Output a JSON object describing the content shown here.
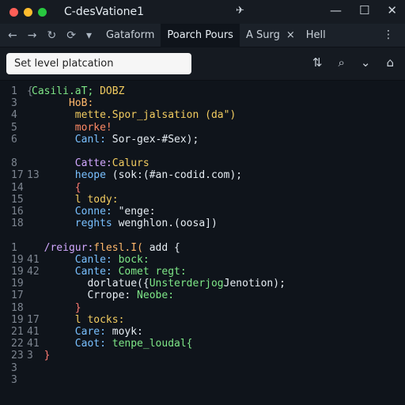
{
  "window": {
    "title": "C-desVatione1",
    "traffic_colors": [
      "#ff5f57",
      "#febc2e",
      "#28c840"
    ],
    "pin_icon": "pin-icon",
    "buttons": [
      "minimize-icon",
      "maximize-icon",
      "close-icon"
    ]
  },
  "toolbar": {
    "icons": [
      "←",
      "→",
      "↻",
      "⟳",
      "▾"
    ],
    "tabs": [
      {
        "label": "Gataform",
        "active": false
      },
      {
        "label": "Poarch Pours",
        "active": true
      },
      {
        "label": "A Surg",
        "active": false
      },
      {
        "label": "Hell",
        "active": false
      }
    ],
    "tab_close": "×",
    "more": "⋮"
  },
  "search": {
    "placeholder": "Set level platcation"
  },
  "searchrow_icons": [
    "⇅",
    "⌕",
    "⌄",
    "⌂"
  ],
  "editor": {
    "lines": [
      {
        "g1": "1",
        "g2": "{",
        "segs": [
          {
            "t": "Casili.aT;",
            "c": "#7ee787"
          },
          {
            "t": " DOBZ",
            "c": "#f2cc60"
          }
        ]
      },
      {
        "g1": "3",
        "g2": "",
        "segs": [
          {
            "t": "      HoB:",
            "c": "#ffb86b"
          }
        ]
      },
      {
        "g1": "4",
        "g2": "",
        "segs": [
          {
            "t": "       mette.",
            "c": "#f2cc60"
          },
          {
            "t": "Spor_jalsation (da\")",
            "c": "#f2cc60"
          }
        ]
      },
      {
        "g1": "5",
        "g2": "",
        "segs": [
          {
            "t": "       morke!",
            "c": "#ff8a65"
          }
        ]
      },
      {
        "g1": "6",
        "g2": "",
        "segs": [
          {
            "t": "       Canl:",
            "c": "#79c0ff"
          },
          {
            "t": " Sor-gex-#Sex);",
            "c": "#e6edf3"
          }
        ]
      },
      {
        "g1": "8",
        "g2": "",
        "segs": [
          {
            "t": "       Catte:",
            "c": "#d2a8ff"
          },
          {
            "t": "Calurs",
            "c": "#f2cc60"
          }
        ]
      },
      {
        "g1": "17",
        "g2": "13",
        "segs": [
          {
            "t": "       heope",
            "c": "#79c0ff"
          },
          {
            "t": " (sok:(#an-codid.com);",
            "c": "#e6edf3"
          }
        ]
      },
      {
        "g1": "14",
        "g2": "",
        "segs": [
          {
            "t": "       {",
            "c": "#ff7b72"
          }
        ]
      },
      {
        "g1": "15",
        "g2": "",
        "segs": [
          {
            "t": "       l",
            "c": "#f2cc60"
          },
          {
            "t": " tody:",
            "c": "#f2cc60"
          }
        ]
      },
      {
        "g1": "16",
        "g2": "",
        "segs": [
          {
            "t": "       Conne:",
            "c": "#79c0ff"
          },
          {
            "t": " \"enge:",
            "c": "#e6edf3"
          }
        ]
      },
      {
        "g1": "18",
        "g2": "",
        "segs": [
          {
            "t": "       reghts",
            "c": "#79c0ff"
          },
          {
            "t": " wenghlon.(oosa])",
            "c": "#e6edf3"
          }
        ]
      },
      {
        "g1": "1",
        "g2": "",
        "segs": [
          {
            "t": "  /reigur:",
            "c": "#d2a8ff"
          },
          {
            "t": "flesl.I(",
            "c": "#ffb86b"
          },
          {
            "t": " add {",
            "c": "#e6edf3"
          }
        ]
      },
      {
        "g1": "19",
        "g2": "41",
        "segs": [
          {
            "t": "       Canle:",
            "c": "#79c0ff"
          },
          {
            "t": " bock:",
            "c": "#7ee787"
          }
        ]
      },
      {
        "g1": "19",
        "g2": "42",
        "segs": [
          {
            "t": "       Cante:",
            "c": "#79c0ff"
          },
          {
            "t": " Comet regt:",
            "c": "#7ee787"
          }
        ]
      },
      {
        "g1": "19",
        "g2": "",
        "segs": [
          {
            "t": "         dorlatue({",
            "c": "#e6edf3"
          },
          {
            "t": "Unsterderjog",
            "c": "#7ee787"
          },
          {
            "t": "Jenotion);",
            "c": "#e6edf3"
          }
        ]
      },
      {
        "g1": "17",
        "g2": "",
        "segs": [
          {
            "t": "         Crrope:",
            "c": "#e6edf3"
          },
          {
            "t": " Neobe:",
            "c": "#7ee787"
          }
        ]
      },
      {
        "g1": "18",
        "g2": "",
        "segs": [
          {
            "t": "       }",
            "c": "#ff7b72"
          }
        ]
      },
      {
        "g1": "19",
        "g2": "17",
        "segs": [
          {
            "t": "       l",
            "c": "#f2cc60"
          },
          {
            "t": " tocks:",
            "c": "#f2cc60"
          }
        ]
      },
      {
        "g1": "21",
        "g2": "41",
        "segs": [
          {
            "t": "       Care:",
            "c": "#79c0ff"
          },
          {
            "t": " moyk:",
            "c": "#e6edf3"
          }
        ]
      },
      {
        "g1": "22",
        "g2": "41",
        "segs": [
          {
            "t": "       Caot:",
            "c": "#79c0ff"
          },
          {
            "t": " tenpe_loudal{",
            "c": "#7ee787"
          }
        ]
      },
      {
        "g1": "23",
        "g2": "3",
        "segs": [
          {
            "t": "  }",
            "c": "#ff7b72"
          }
        ]
      },
      {
        "g1": "3",
        "g2": "",
        "segs": []
      },
      {
        "g1": "3",
        "g2": "",
        "segs": []
      }
    ]
  }
}
